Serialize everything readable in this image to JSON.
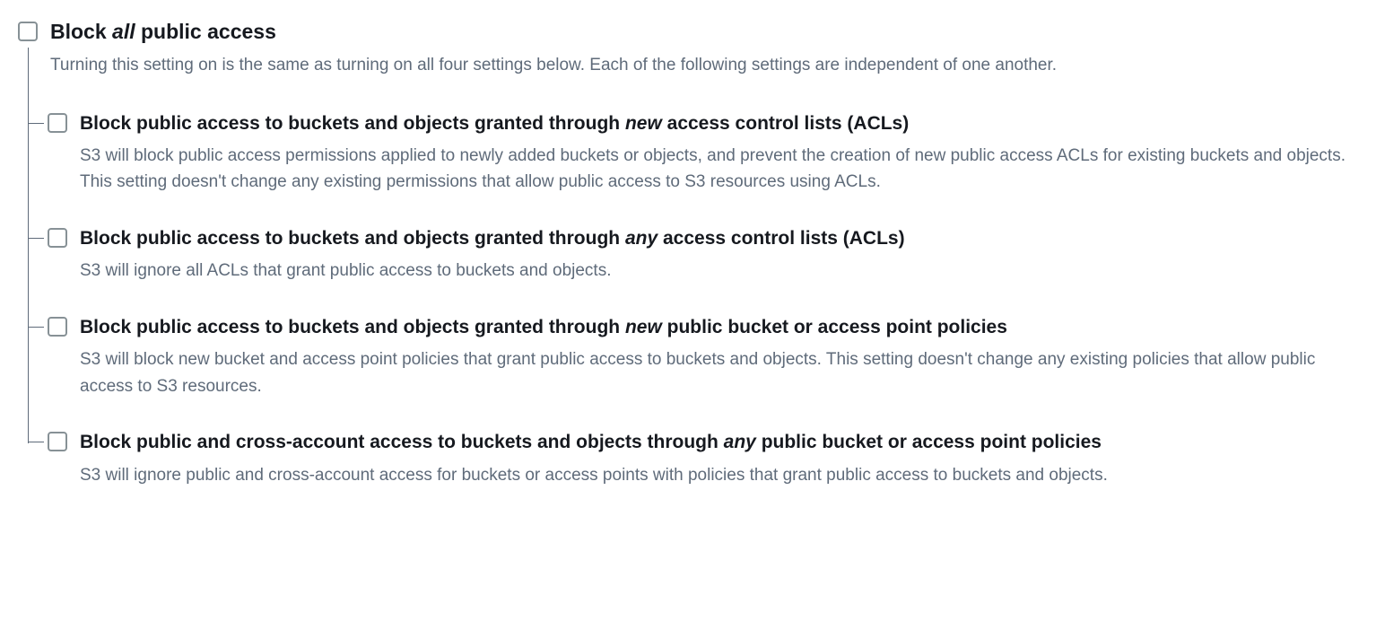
{
  "master": {
    "label_pre": "Block ",
    "label_em": "all",
    "label_post": " public access",
    "description": "Turning this setting on is the same as turning on all four settings below. Each of the following settings are independent of one another."
  },
  "options": [
    {
      "label_pre": "Block public access to buckets and objects granted through ",
      "label_em": "new",
      "label_post": " access control lists (ACLs)",
      "description": "S3 will block public access permissions applied to newly added buckets or objects, and prevent the creation of new public access ACLs for existing buckets and objects. This setting doesn't change any existing permissions that allow public access to S3 resources using ACLs."
    },
    {
      "label_pre": "Block public access to buckets and objects granted through ",
      "label_em": "any",
      "label_post": " access control lists (ACLs)",
      "description": "S3 will ignore all ACLs that grant public access to buckets and objects."
    },
    {
      "label_pre": "Block public access to buckets and objects granted through ",
      "label_em": "new",
      "label_post": " public bucket or access point policies",
      "description": "S3 will block new bucket and access point policies that grant public access to buckets and objects. This setting doesn't change any existing policies that allow public access to S3 resources."
    },
    {
      "label_pre": "Block public and cross-account access to buckets and objects through ",
      "label_em": "any",
      "label_post": " public bucket or access point policies",
      "description": "S3 will ignore public and cross-account access for buckets or access points with policies that grant public access to buckets and objects."
    }
  ]
}
